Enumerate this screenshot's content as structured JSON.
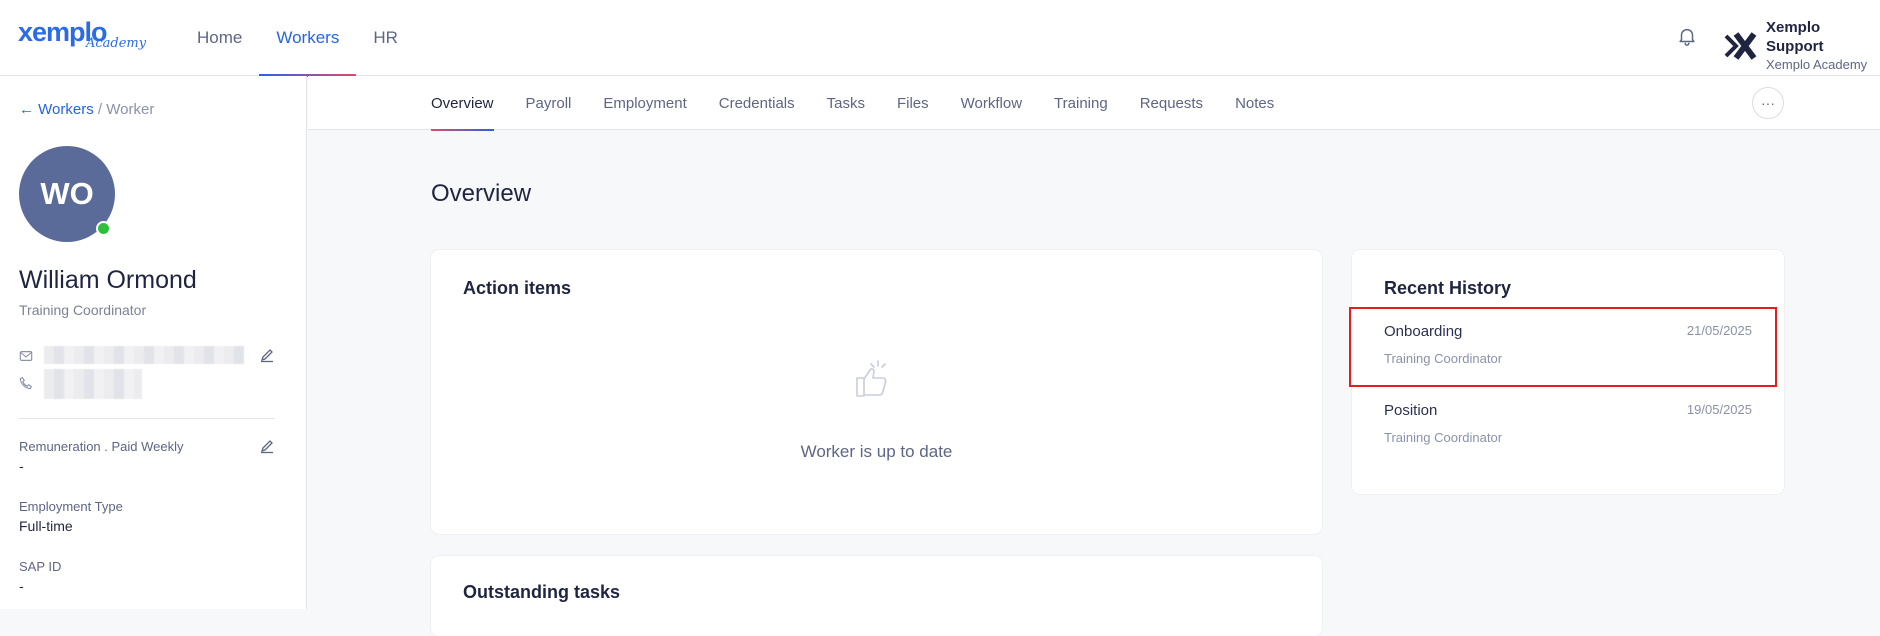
{
  "brand": {
    "logo_text": "xemplo",
    "logo_sub": "Academy",
    "accent": "#2563eb"
  },
  "topnav": {
    "items": [
      "Home",
      "Workers",
      "HR"
    ],
    "active": "Workers"
  },
  "user": {
    "name": "Xemplo Support",
    "org": "Xemplo Academy"
  },
  "breadcrumb": {
    "back_link": "← Workers",
    "separator": "/",
    "current": "Worker"
  },
  "worker": {
    "initials": "WO",
    "name": "William Ormond",
    "role": "Training Coordinator",
    "status_color": "#2fbf3c"
  },
  "fields": [
    {
      "label": "Remuneration . Paid Weekly",
      "value": "-"
    },
    {
      "label": "Employment Type",
      "value": "Full-time"
    },
    {
      "label": "SAP ID",
      "value": "-"
    }
  ],
  "subnav": {
    "tabs": [
      "Overview",
      "Payroll",
      "Employment",
      "Credentials",
      "Tasks",
      "Files",
      "Workflow",
      "Training",
      "Requests",
      "Notes"
    ],
    "active": "Overview",
    "more_label": "···"
  },
  "main": {
    "title": "Overview",
    "action_items": {
      "title": "Action items",
      "empty_text": "Worker is up to date"
    },
    "outstanding_tasks": {
      "title": "Outstanding tasks"
    },
    "recent_history": {
      "title": "Recent History",
      "items": [
        {
          "title": "Onboarding",
          "subtitle": "Training Coordinator",
          "date": "21/05/2025"
        },
        {
          "title": "Position",
          "subtitle": "Training Coordinator",
          "date": "19/05/2025"
        }
      ]
    }
  }
}
